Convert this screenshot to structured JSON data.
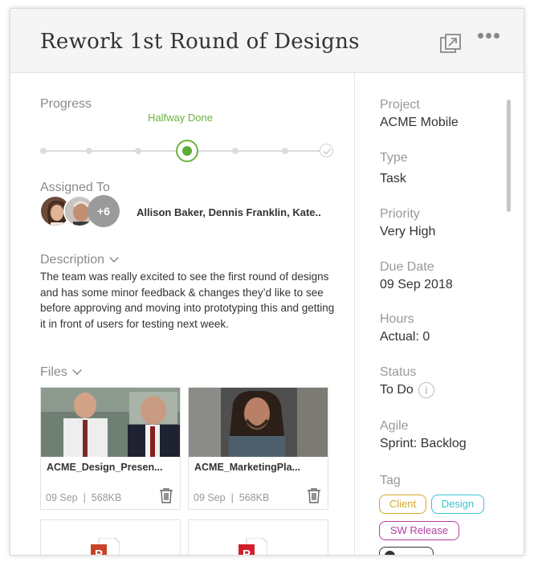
{
  "header": {
    "title": "Rework 1st Round of Designs",
    "popout_icon": "popout-icon",
    "more_icon": "more-horizontal-icon"
  },
  "progress": {
    "label": "Progress",
    "status": "Halfway Done",
    "steps_total": 7,
    "current_step": 4,
    "accent": "#6bb33b"
  },
  "assigned": {
    "label": "Assigned To",
    "more_count": "+6",
    "names": "Allison Baker, Dennis Franklin, Kate.."
  },
  "description": {
    "label": "Description",
    "text": "The team was really excited to see the first round of designs and has some minor feedback & changes they’d like to see before approving and moving into prototyping this and getting it in front of users for testing next week."
  },
  "files": {
    "label": "Files",
    "items": [
      {
        "name": "ACME_Design_Presen...",
        "date": "09 Sep",
        "size": "568KB"
      },
      {
        "name": "ACME_MarketingPla...",
        "date": "09 Sep",
        "size": "568KB"
      }
    ]
  },
  "details": {
    "project_label": "Project",
    "project_value": "ACME Mobile",
    "type_label": "Type",
    "type_value": "Task",
    "priority_label": "Priority",
    "priority_value": "Very High",
    "due_label": "Due Date",
    "due_value": "09 Sep 2018",
    "hours_label": "Hours",
    "hours_value": "Actual: 0",
    "status_label": "Status",
    "status_value": "To Do",
    "agile_label": "Agile",
    "agile_value": "Sprint: Backlog",
    "tag_label": "Tag",
    "tags": [
      {
        "label": "Client",
        "color": "#d4a82a"
      },
      {
        "label": "Design",
        "color": "#3cc3cf"
      },
      {
        "label": "SW Release",
        "color": "#b03fa0"
      }
    ]
  }
}
